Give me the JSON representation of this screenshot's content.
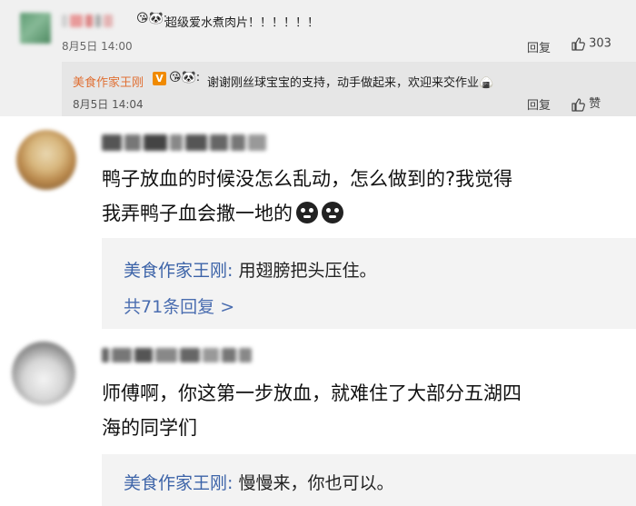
{
  "top_comment": {
    "emoji": "😘🐼:",
    "text": "超级爱水煮肉片！！！！！！",
    "date": "8月5日",
    "time": "14:00",
    "reply_label": "回复",
    "like_count": "303"
  },
  "author_reply": {
    "name": "美食作家王刚",
    "verified_badge": "V",
    "emoji": "😘🐼:",
    "text": "谢谢刚丝球宝宝的支持，动手做起来，欢迎来交作业",
    "text_emoji": "🍙",
    "date": "8月5日",
    "time": "14:04",
    "reply_label": "回复",
    "like_label": "赞"
  },
  "comment1": {
    "text_line1": "鸭子放血的时候没怎么乱动，怎么做到的?我觉得",
    "text_line2": "我弄鸭子血会撒一地的",
    "author_reply_name": "美食作家王刚",
    "author_reply_sep": ":",
    "author_reply_text": "用翅膀把头压住。",
    "more_replies": "共71条回复 >"
  },
  "comment2": {
    "text_line1": "师傅啊，你这第一步放血，就难住了大部分五湖四",
    "text_line2": "海的同学们",
    "author_reply_name": "美食作家王刚",
    "author_reply_sep": ":",
    "author_reply_text": "慢慢来，你也可以。"
  },
  "colors": {
    "author_link": "#3c63a8",
    "author_orange": "#e07034",
    "badge": "#f08a00",
    "top_bg": "#f0f0f0",
    "reply_bg": "#f3f3f3"
  }
}
